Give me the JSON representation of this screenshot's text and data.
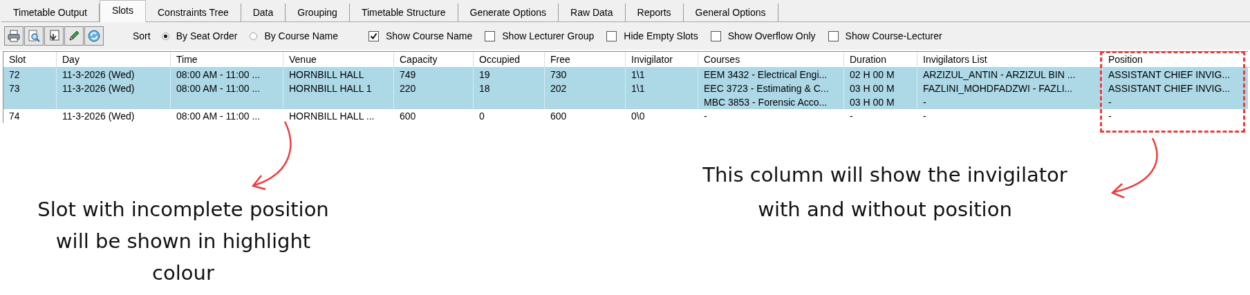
{
  "tabs": [
    {
      "label": "Timetable Output",
      "selected": false
    },
    {
      "label": "Slots",
      "selected": true
    },
    {
      "label": "Constraints Tree",
      "selected": false
    },
    {
      "label": "Data",
      "selected": false
    },
    {
      "label": "Grouping",
      "selected": false
    },
    {
      "label": "Timetable Structure",
      "selected": false
    },
    {
      "label": "Generate Options",
      "selected": false
    },
    {
      "label": "Raw Data",
      "selected": false
    },
    {
      "label": "Reports",
      "selected": false
    },
    {
      "label": "General Options",
      "selected": false
    }
  ],
  "toolbar": {
    "buttons": [
      {
        "kind": "print"
      },
      {
        "kind": "preview"
      },
      {
        "kind": "export"
      },
      {
        "kind": "edit"
      },
      {
        "kind": "refresh"
      }
    ],
    "sort_label": "Sort",
    "sort_options": [
      {
        "label": "By Seat Order",
        "selected": true
      },
      {
        "label": "By Course Name",
        "selected": false
      }
    ],
    "checkboxes": [
      {
        "label": "Show Course Name",
        "checked": true
      },
      {
        "label": "Show Lecturer Group",
        "checked": false
      },
      {
        "label": "Hide Empty Slots",
        "checked": false
      },
      {
        "label": "Show Overflow Only",
        "checked": false
      },
      {
        "label": "Show Course-Lecturer",
        "checked": false
      }
    ]
  },
  "table": {
    "columns": [
      "Slot",
      "Day",
      "Time",
      "Venue",
      "Capacity",
      "Occupied",
      "Free",
      "Invigilator",
      "Courses",
      "Duration",
      "Invigilators List",
      "Position"
    ],
    "rows": [
      {
        "highlighted": true,
        "cells": [
          "72",
          "11-3-2026 (Wed)",
          "08:00 AM - 11:00 ...",
          "HORNBILL HALL",
          "749",
          "19",
          "730",
          "1\\1",
          "EEM 3432 - Electrical Engi...",
          "02 H 00 M",
          "ARZIZUL_ANTIN - ARZIZUL BIN ...",
          "ASSISTANT CHIEF INVIG..."
        ]
      },
      {
        "highlighted": true,
        "cells": [
          "73",
          "11-3-2026 (Wed)",
          "08:00 AM - 11:00 ...",
          "HORNBILL HALL 1",
          "220",
          "18",
          "202",
          "1\\1",
          "EEC 3723 - Estimating & C...",
          "03 H 00 M",
          "FAZLINI_MOHDFADZWI - FAZLI...",
          "ASSISTANT CHIEF INVIG..."
        ]
      },
      {
        "highlighted": true,
        "cells": [
          null,
          null,
          null,
          null,
          null,
          null,
          null,
          null,
          "MBC 3853 - Forensic Acco...",
          "03 H 00 M",
          "-",
          "-"
        ]
      },
      {
        "highlighted": false,
        "cells": [
          "74",
          "11-3-2026 (Wed)",
          "08:00 AM - 11:00 ...",
          "HORNBILL HALL ...",
          "600",
          "0",
          "600",
          "0\\0",
          "-",
          "-",
          "-",
          "-"
        ]
      }
    ]
  },
  "annotations": {
    "left_caption": "Slot with incomplete position will be shown in highlight colour",
    "right_caption": "This column will show the invigilator with and without position"
  }
}
